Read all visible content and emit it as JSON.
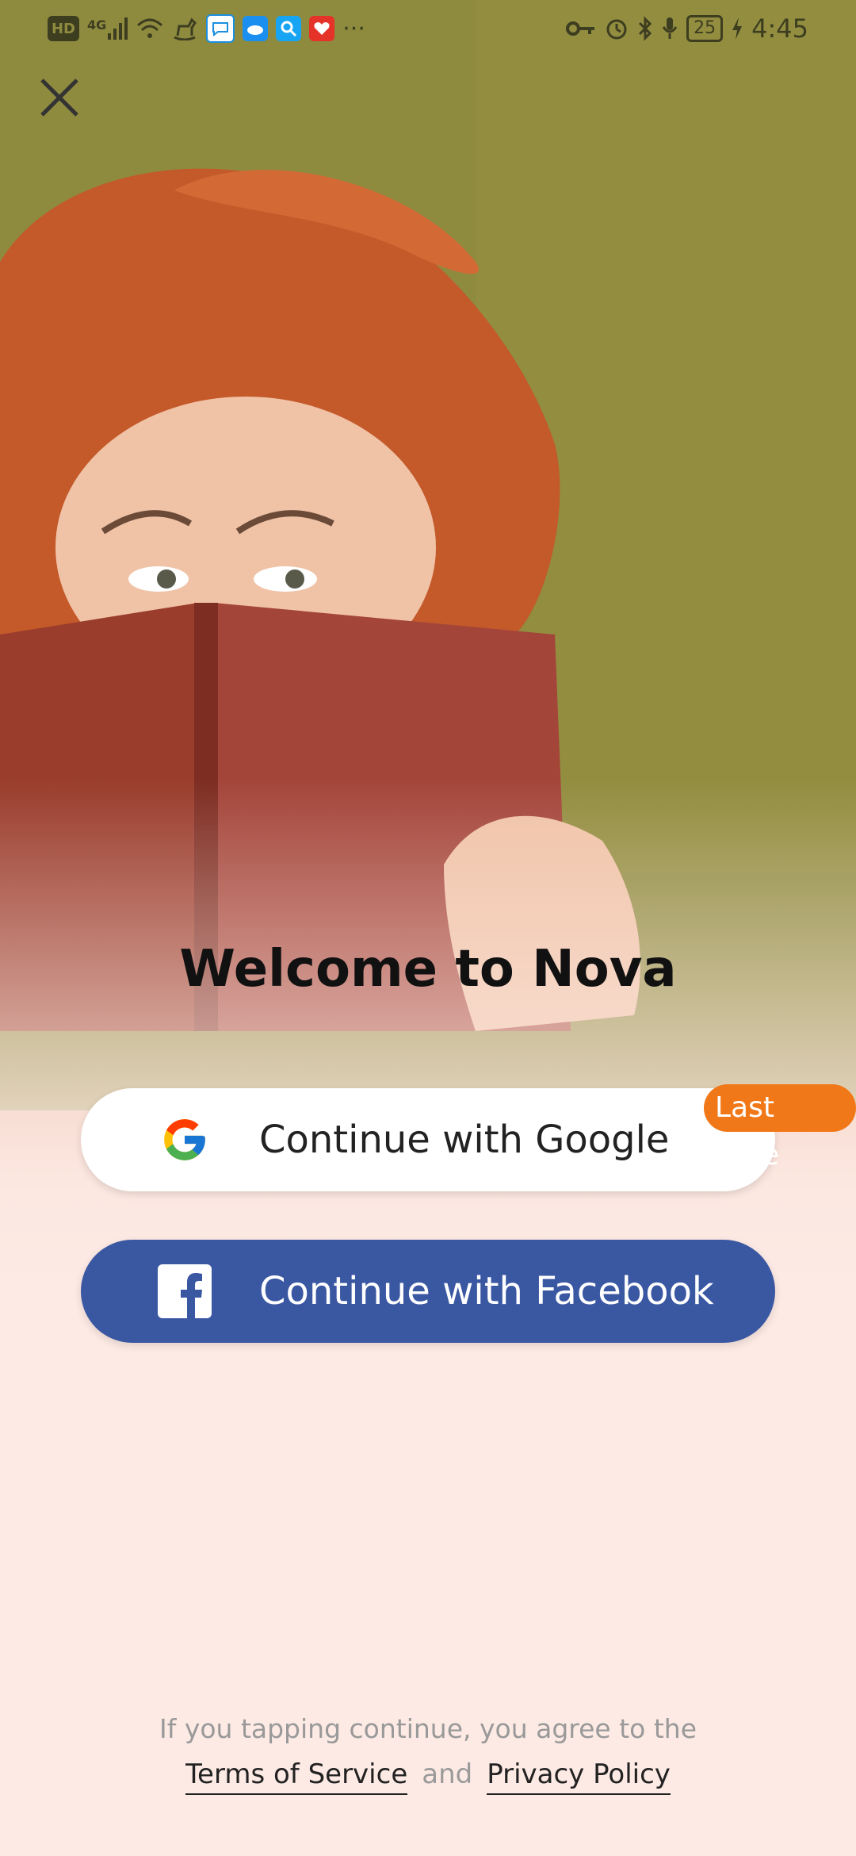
{
  "status_bar": {
    "left_icons": [
      "hd-icon",
      "signal-4g-icon",
      "wifi-icon",
      "rocking-horse-icon",
      "chat-app-icon",
      "weather-app-icon",
      "search-app-icon",
      "shopping-app-icon",
      "more-icon"
    ],
    "hd_label": "HD",
    "network_label": "4G",
    "more_label": "···",
    "battery_level": "25",
    "time": "4:45"
  },
  "close_icon": "close-icon",
  "welcome_title": "Welcome to Nova",
  "buttons": {
    "google_label": "Continue with Google",
    "facebook_label": "Continue with Facebook",
    "last_time_badge": "Last time"
  },
  "colors": {
    "facebook_blue": "#3a57a2",
    "badge_orange": "#f17818",
    "background_pink": "#fdeae4"
  },
  "legal": {
    "line1": "If you tapping continue, you agree to the",
    "terms_label": "Terms of Service",
    "and_label": "and",
    "privacy_label": "Privacy Policy"
  }
}
